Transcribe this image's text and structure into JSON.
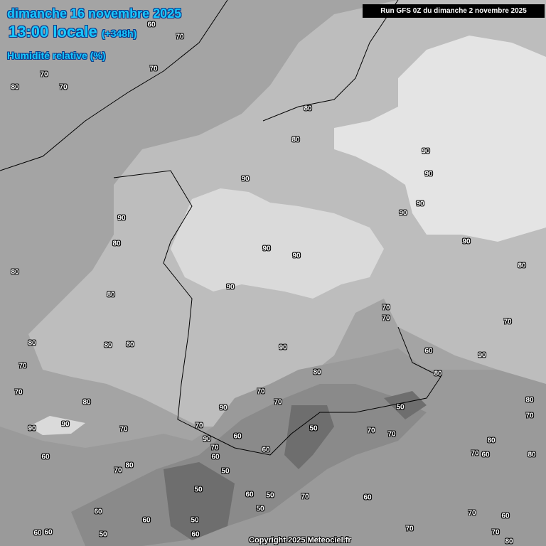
{
  "header": {
    "date": "dimanche 16 novembre 2025",
    "time": "13:00 locale",
    "lead": "(+348h)",
    "parameter": "Humidité relative (%)",
    "run": "Run GFS 0Z du dimanche 2 novembre 2025"
  },
  "footer": {
    "copyright": "Copyright 2025 Meteociel.fr"
  },
  "colors": {
    "title": "#19c8ff",
    "h50": "#6e6e6e",
    "h60": "#888888",
    "h70": "#a8a8a8",
    "h80": "#c4c4c4",
    "h90": "#e2e2e2"
  },
  "contour_labels": [
    60,
    70,
    70,
    80,
    70,
    70,
    80,
    80,
    90,
    90,
    90,
    90,
    80,
    90,
    90,
    90,
    90,
    90,
    80,
    80,
    90,
    80,
    70,
    70,
    70,
    80,
    80,
    80,
    90,
    60,
    90,
    70,
    80,
    80,
    70,
    70,
    70,
    80,
    90,
    50,
    80,
    70,
    90,
    90,
    70,
    70,
    50,
    70,
    70,
    60,
    90,
    70,
    60,
    60,
    60,
    70,
    80,
    50,
    70,
    60,
    80,
    80,
    50,
    60,
    50,
    70,
    60,
    60,
    50,
    70,
    60,
    50,
    60,
    60,
    60,
    50,
    60,
    70,
    70,
    80
  ]
}
